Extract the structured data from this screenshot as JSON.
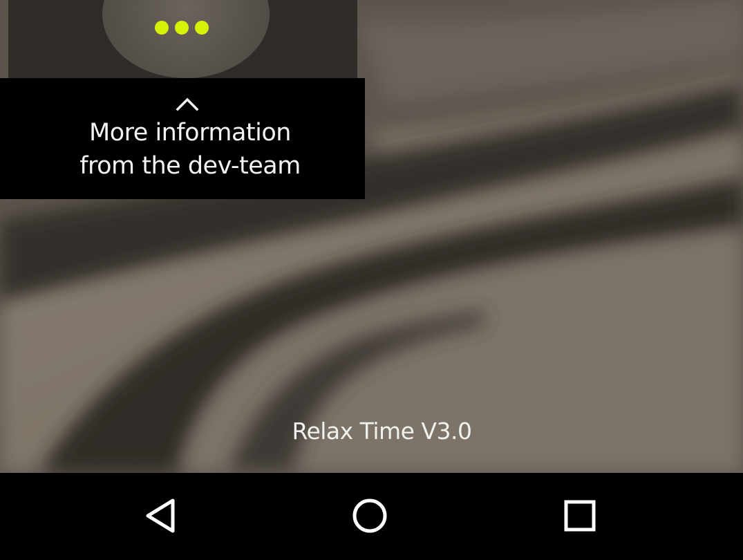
{
  "info_panel": {
    "line1": "More information",
    "line2": "from the dev-team"
  },
  "app": {
    "version_label": "Relax Time V3.0"
  },
  "menu": {
    "icon": "more-horizontal-icon",
    "dot_color": "#d7f20a"
  },
  "navigation": {
    "back_icon": "back-triangle-icon",
    "home_icon": "home-circle-icon",
    "recents_icon": "recents-square-icon"
  },
  "colors": {
    "accent": "#d7f20a",
    "info_background": "#000000",
    "nav_background": "#000000"
  }
}
